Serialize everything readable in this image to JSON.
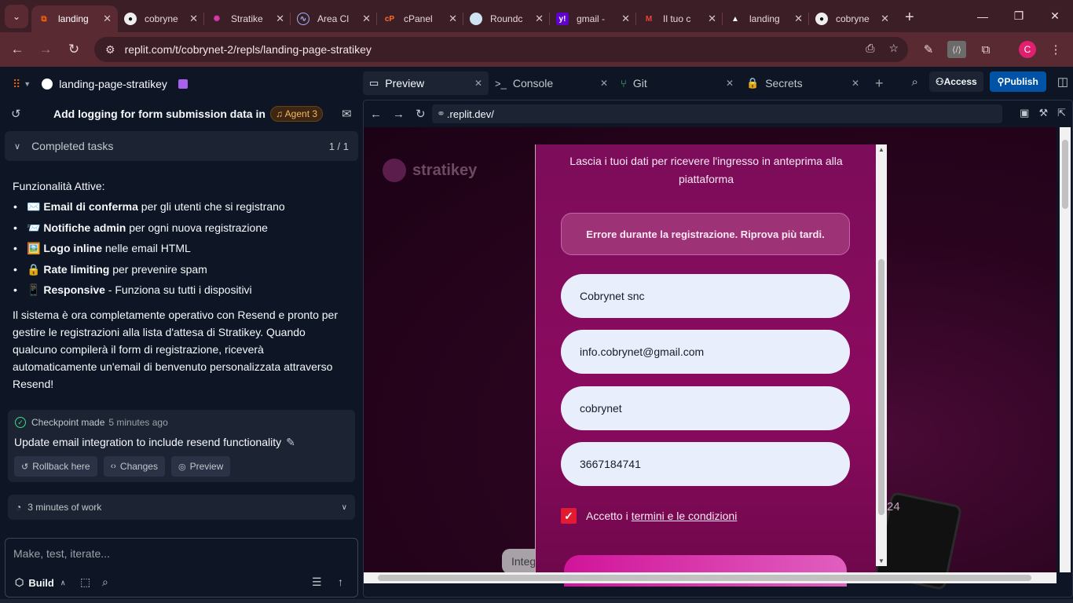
{
  "browser": {
    "tabs": [
      {
        "title": "landing",
        "icon": "replit-icon",
        "active": true
      },
      {
        "title": "cobryne",
        "icon": "github-icon"
      },
      {
        "title": "Stratike",
        "icon": "stratikey-icon"
      },
      {
        "title": "Area Cl",
        "icon": "area-icon"
      },
      {
        "title": "cPanel",
        "icon": "cpanel-icon"
      },
      {
        "title": "Roundc",
        "icon": "roundcube-icon"
      },
      {
        "title": "gmail -",
        "icon": "yahoo-icon"
      },
      {
        "title": "Il tuo c",
        "icon": "gmail-icon"
      },
      {
        "title": "landing",
        "icon": "vercel-icon"
      },
      {
        "title": "cobryne",
        "icon": "github-icon"
      }
    ],
    "url": "replit.com/t/cobrynet-2/repls/landing-page-stratikey",
    "avatar_letter": "C"
  },
  "replit": {
    "project_name": "landing-page-stratikey",
    "thread_title": "Add logging for form submission data in t...",
    "agent_badge": "Agent 3",
    "completed_label": "Completed tasks",
    "completed_count": "1 / 1",
    "message": {
      "heading": "Funzionalità Attive:",
      "items": [
        {
          "emoji": "✉️",
          "bold": "Email di conferma",
          "rest": " per gli utenti che si registrano"
        },
        {
          "emoji": "📨",
          "bold": "Notifiche admin",
          "rest": " per ogni nuova registrazione"
        },
        {
          "emoji": "🖼️",
          "bold": "Logo inline",
          "rest": " nelle email HTML"
        },
        {
          "emoji": "🔒",
          "bold": "Rate limiting",
          "rest": " per prevenire spam"
        },
        {
          "emoji": "📱",
          "bold": "Responsive",
          "rest": " - Funziona su tutti i dispositivi"
        }
      ],
      "paragraph": "Il sistema è ora completamente operativo con Resend e pronto per gestire le registrazioni alla lista d'attesa di Stratikey. Quando qualcuno compilerà il form di registrazione, riceverà automaticamente un'email di benvenuto personalizzata attraverso Resend!"
    },
    "checkpoint": {
      "label": "Checkpoint made",
      "ago": "5 minutes ago",
      "title": "Update email integration to include resend functionality",
      "buttons": [
        "Rollback here",
        "Changes",
        "Preview"
      ]
    },
    "work_label": "3 minutes of work",
    "composer_placeholder": "Make, test, iterate...",
    "build_label": "Build"
  },
  "workspace": {
    "tabs": [
      "Preview",
      "Console",
      "Git",
      "Secrets"
    ],
    "access_label": "Access",
    "publish_label": "Publish",
    "preview_url": ".replit.dev/"
  },
  "site": {
    "brand": "stratikey",
    "intro": "Lascia i tuoi dati per ricevere l'ingresso in anteprima alla piattaforma",
    "error": "Errore durante la registrazione. Riprova più tardi.",
    "fields": [
      "Cobrynet snc",
      "info.cobrynet@gmail.com",
      "cobrynet",
      "3667184741"
    ],
    "consent_prefix": "Accetto i",
    "consent_link": "termini e le condizioni",
    "pill_text": "Integ",
    "badge_number": "24"
  }
}
